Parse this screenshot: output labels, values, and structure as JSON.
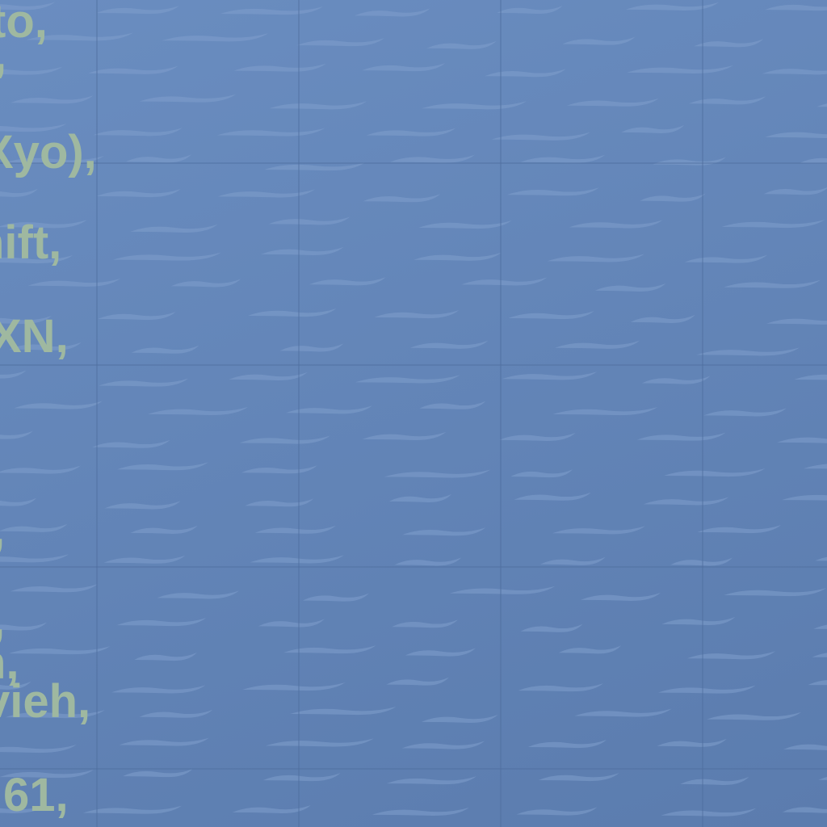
{
  "map": {
    "surface": "ocean",
    "pattern": "waves",
    "colors": {
      "water_light": "#6a8dc0",
      "water_dark": "#5b7cae",
      "wave": "#7f9fcc",
      "tile_line": "#4f6e9e",
      "label_text": "#9fb8a0"
    }
  },
  "labels": [
    "to,",
    ",",
    "Xyo),",
    "nift,",
    "XN,",
    ",",
    ",",
    "h,",
    "vieh,",
    "61,"
  ]
}
